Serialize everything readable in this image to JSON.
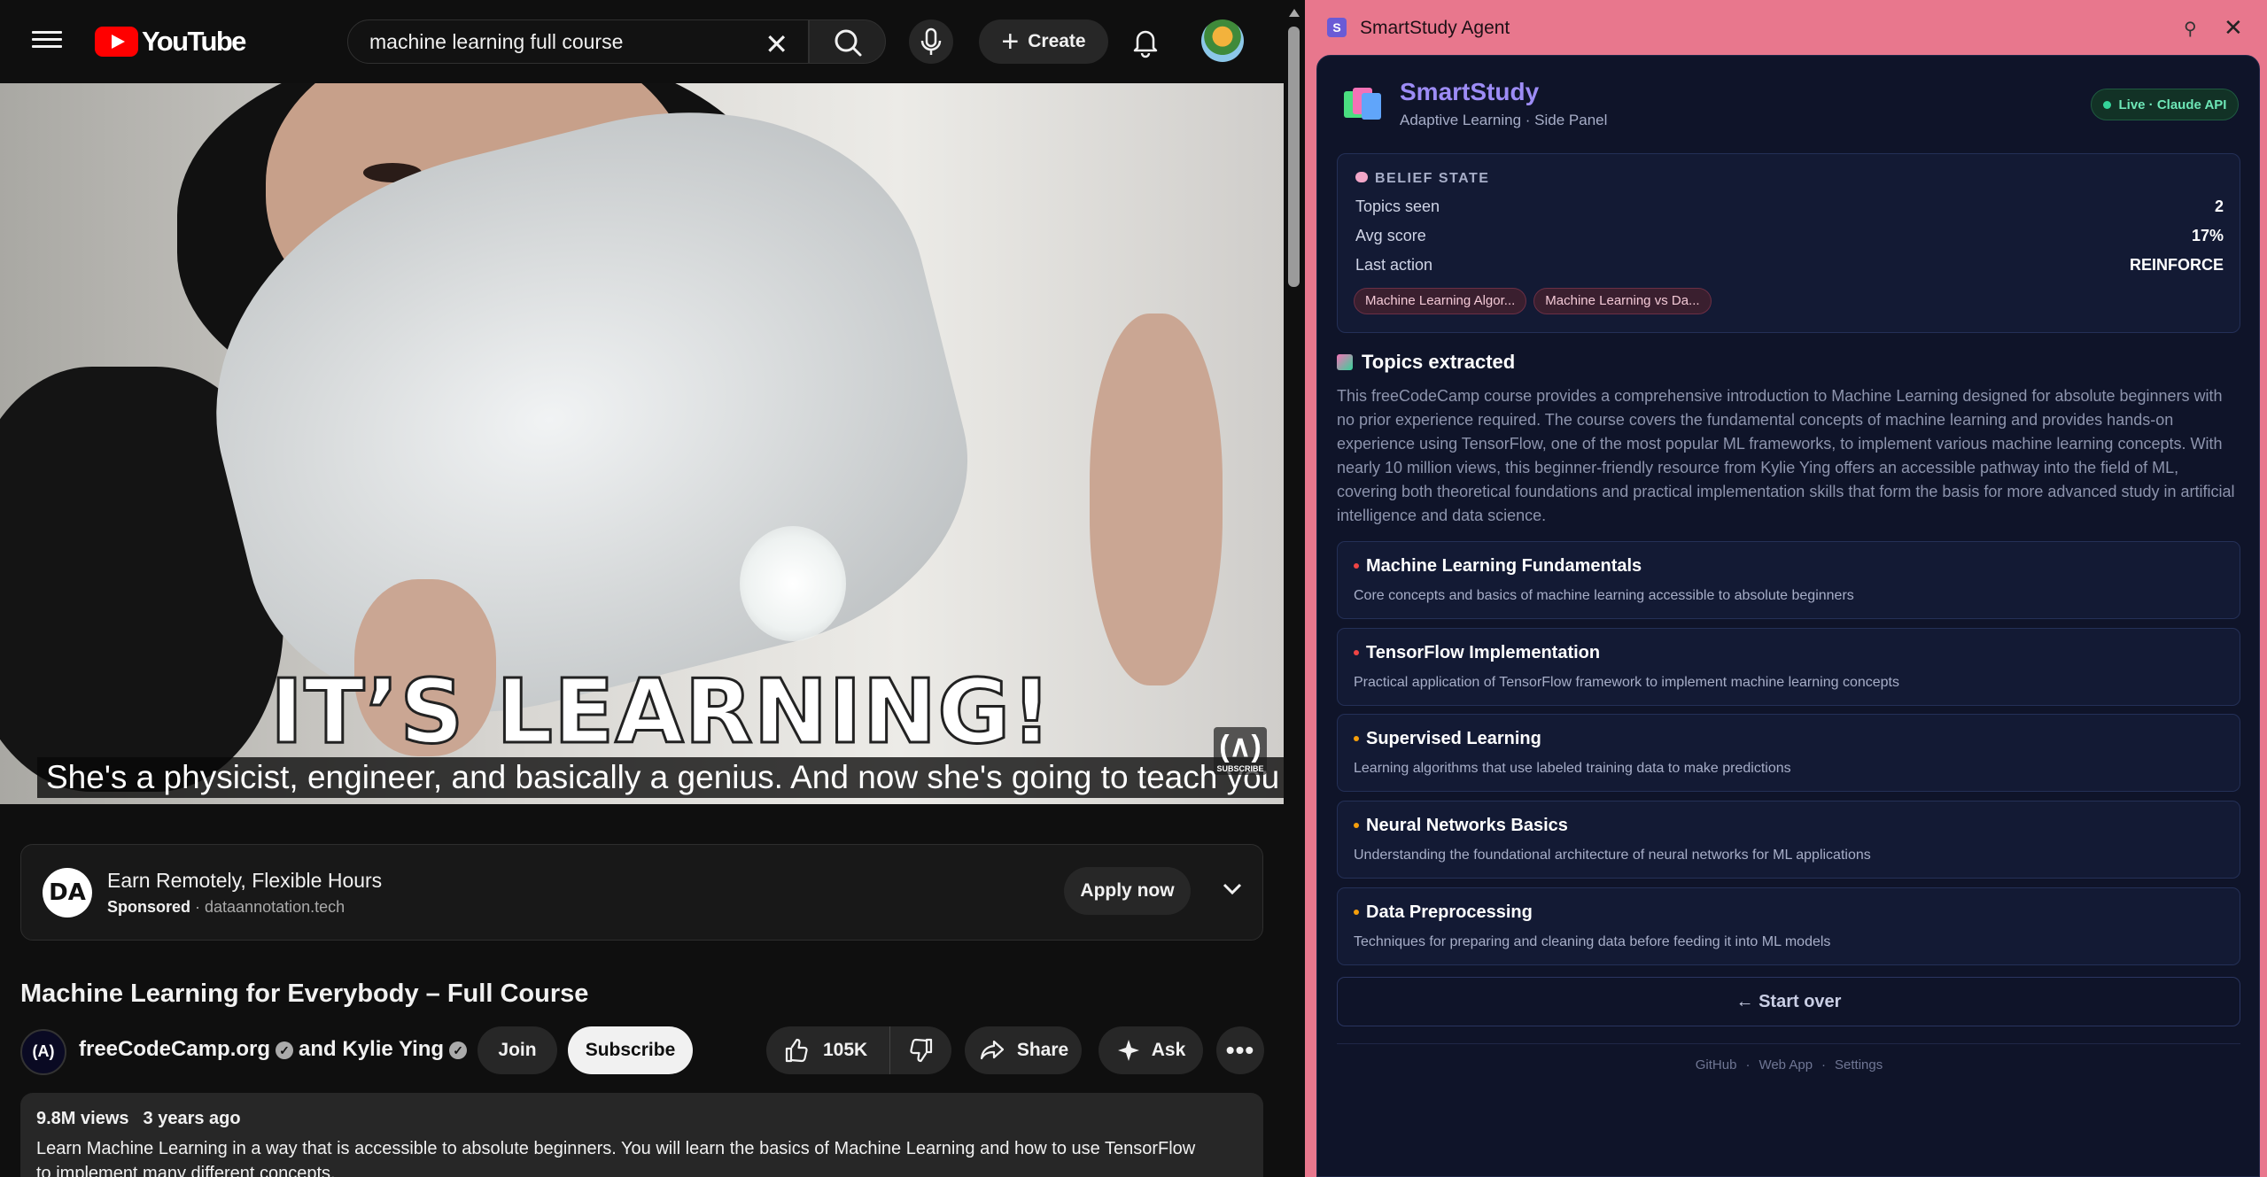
{
  "youtube": {
    "logo_text": "YouTube",
    "search": {
      "value": "machine learning full course"
    },
    "create_label": "Create",
    "video": {
      "overlay_text": "IT’S LEARNING!",
      "caption": "She's a physicist, engineer, and basically a genius. And now she's going to teach you",
      "watermark": "SUBSCRIBE"
    },
    "ad": {
      "logo": "DA",
      "title": "Earn Remotely, Flexible Hours",
      "sponsored": "Sponsored",
      "domain": "dataannotation.tech",
      "cta": "Apply now"
    },
    "title": "Machine Learning for Everybody – Full Course",
    "channel": {
      "name": "freeCodeCamp.org",
      "collab": "and Kylie Ying",
      "avatar": "(A)"
    },
    "buttons": {
      "join": "Join",
      "subscribe": "Subscribe",
      "likes": "105K",
      "share": "Share",
      "ask": "Ask"
    },
    "description": {
      "views": "9.8M views",
      "age": "3 years ago",
      "text": "Learn Machine Learning in a way that is accessible to absolute beginners. You will learn the basics of Machine Learning and how to use TensorFlow to implement many different concepts."
    }
  },
  "side_panel": {
    "window_title": "SmartStudy Agent",
    "app_name": "SmartStudy",
    "tagline": "Adaptive Learning · Side Panel",
    "status_badge": "Live · Claude API",
    "belief": {
      "heading": "BELIEF STATE",
      "rows": [
        {
          "label": "Topics seen",
          "value": "2"
        },
        {
          "label": "Avg score",
          "value": "17%"
        },
        {
          "label": "Last action",
          "value": "REINFORCE"
        }
      ],
      "chips": [
        "Machine Learning Algor...",
        "Machine Learning vs Da..."
      ]
    },
    "topics_heading": "Topics extracted",
    "summary": "This freeCodeCamp course provides a comprehensive introduction to Machine Learning designed for absolute beginners with no prior experience required. The course covers the fundamental concepts of machine learning and provides hands-on experience using TensorFlow, one of the most popular ML frameworks, to implement various machine learning concepts. With nearly 10 million views, this beginner-friendly resource from Kylie Ying offers an accessible pathway into the field of ML, covering both theoretical foundations and practical implementation skills that form the basis for more advanced study in artificial intelligence and data science.",
    "topics": [
      {
        "title": "Machine Learning Fundamentals",
        "desc": "Core concepts and basics of machine learning accessible to absolute beginners",
        "color": "#ef4444"
      },
      {
        "title": "TensorFlow Implementation",
        "desc": "Practical application of TensorFlow framework to implement machine learning concepts",
        "color": "#ef4444"
      },
      {
        "title": "Supervised Learning",
        "desc": "Learning algorithms that use labeled training data to make predictions",
        "color": "#f59e0b"
      },
      {
        "title": "Neural Networks Basics",
        "desc": "Understanding the foundational architecture of neural networks for ML applications",
        "color": "#f59e0b"
      },
      {
        "title": "Data Preprocessing",
        "desc": "Techniques for preparing and cleaning data before feeding it into ML models",
        "color": "#f59e0b"
      }
    ],
    "start_over": "← Start over",
    "footer_links": [
      "GitHub",
      "Web App",
      "Settings"
    ]
  }
}
